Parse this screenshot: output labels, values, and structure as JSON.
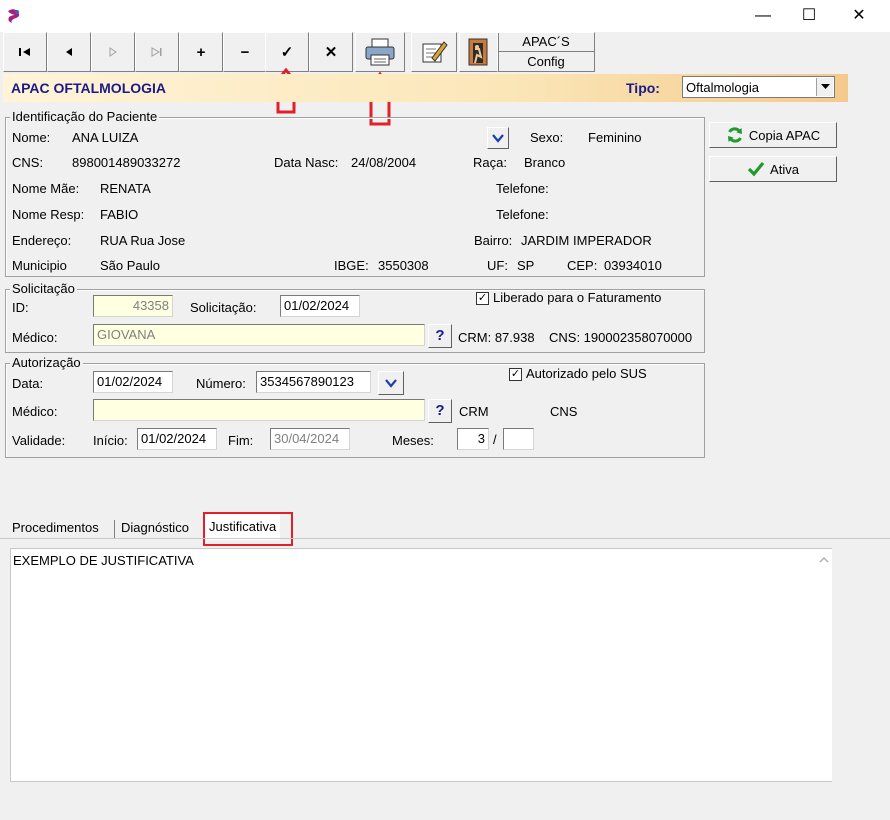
{
  "window": {
    "minimize_label": "—",
    "maximize_label": "☐",
    "close_label": "✕"
  },
  "toolbar": {
    "plus_label": "+",
    "minus_label": "−",
    "confirm_label": "✓",
    "cancel_label": "✕",
    "apac_config_line1": "APAC´S",
    "apac_config_line2": "Config"
  },
  "header": {
    "title": "APAC OFTALMOLOGIA",
    "tipo_label": "Tipo:",
    "tipo_value": "Oftalmologia"
  },
  "patient": {
    "group_title": "Identificação do Paciente",
    "nome_label": "Nome:",
    "nome_value": "ANA LUIZA",
    "sexo_label": "Sexo:",
    "sexo_value": "Feminino",
    "cns_label": "CNS:",
    "cns_value": "898001489033272",
    "data_nasc_label": "Data Nasc:",
    "data_nasc_value": "24/08/2004",
    "raca_label": "Raça:",
    "raca_value": "Branco",
    "nome_mae_label": "Nome Mãe:",
    "nome_mae_value": "RENATA",
    "telefone_label": "Telefone:",
    "nome_resp_label": "Nome Resp:",
    "nome_resp_value": "FABIO",
    "endereco_label": "Endereço:",
    "endereco_value": "RUA Rua Jose",
    "bairro_label": "Bairro:",
    "bairro_value": "JARDIM IMPERADOR",
    "municipio_label": "Municipio",
    "municipio_value": "São Paulo",
    "ibge_label": "IBGE:",
    "ibge_value": "3550308",
    "uf_label": "UF:",
    "uf_value": "SP",
    "cep_label": "CEP:",
    "cep_value": "03934010"
  },
  "side_buttons": {
    "copia_label": "Copia APAC",
    "ativa_label": "Ativa"
  },
  "solicitacao": {
    "group_title": "Solicitação",
    "id_label": "ID:",
    "id_value": "43358",
    "solicitacao_label": "Solicitação:",
    "solicitacao_value": "01/02/2024",
    "liberado_label": "Liberado para o Faturamento",
    "liberado_checked": "✓",
    "medico_label": "Médico:",
    "medico_value": "GIOVANA",
    "help_label": "?",
    "crm_text": "CRM: 87.938",
    "cns_text": "CNS: 190002358070000"
  },
  "autorizacao": {
    "group_title": "Autorização",
    "data_label": "Data:",
    "data_value": "01/02/2024",
    "numero_label": "Número:",
    "numero_value": "3534567890123",
    "autorizado_label": "Autorizado pelo SUS",
    "autorizado_checked": "✓",
    "medico_label": "Médico:",
    "medico_value": "",
    "help_label": "?",
    "crm_label": "CRM",
    "cns_label": "CNS",
    "validade_label": "Validade:",
    "inicio_label": "Início:",
    "inicio_value": "01/02/2024",
    "fim_label": "Fim:",
    "fim_value": "30/04/2024",
    "meses_label": "Meses:",
    "meses_value": "3",
    "meses_sep": "/",
    "meses_total": ""
  },
  "tabs": {
    "procedimentos": "Procedimentos",
    "diagnostico": "Diagnóstico",
    "justificativa": "Justificativa"
  },
  "justificativa": {
    "text": "EXEMPLO DE JUSTIFICATIVA"
  },
  "colors": {
    "title_blue": "#1a1a8c",
    "annotation_red": "#e0212a"
  }
}
